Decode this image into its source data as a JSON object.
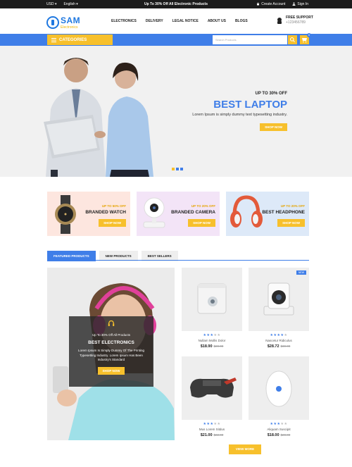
{
  "topbar": {
    "currency": "USD",
    "language": "English",
    "promo": "Up To 30% Off All Electronic Products",
    "account": "Create Account",
    "signin": "Sign In"
  },
  "header": {
    "logo_main": "SAM",
    "logo_sub": "Electronics",
    "nav": [
      "ELECTRONICS",
      "DELIVERY",
      "LEGAL NOTICE",
      "ABOUT US",
      "BLOGS"
    ],
    "support_title": "FREE SUPPORT",
    "support_phone": "+123456789"
  },
  "bar": {
    "categories": "CATEGORIES",
    "search_placeholder": "Search Products",
    "cart_count": "0"
  },
  "hero": {
    "offer": "UP TO 30% OFF",
    "title": "BEST LAPTOP",
    "desc": "Lorem Ipsum is simply dummy text  typesetting industry.",
    "button": "SHOP NOW"
  },
  "promos": [
    {
      "offer": "UP TO 50% OFF",
      "name": "BRANDED WATCH",
      "button": "SHOP NOW"
    },
    {
      "offer": "UP TO 20% OFF",
      "name": "BRANDED CAMERA",
      "button": "SHOP NOW"
    },
    {
      "offer": "UP TO 20% OFF",
      "name": "BEST HEADPHONE",
      "button": "SHOP NOW"
    }
  ],
  "tabs": [
    "FEATURED PRODUCTS",
    "NEW PRODUCTS",
    "BEST SELLERS"
  ],
  "side_promo": {
    "offer": "Up To 30% Off All Products",
    "title": "BEST ELECTRONICS",
    "desc": "Lorem Ipsum Is Simply Dummy Of The Printing Typesetting Industry. Lorem Ipsum Has Been Industry's Standard",
    "button": "SHOP NOW"
  },
  "products": [
    {
      "name": "Nullam Mollis Dolor",
      "price": "$18.90",
      "old": "$20.00",
      "rating": 4,
      "badge": ""
    },
    {
      "name": "Nascetur Ridiculus",
      "price": "$28.72",
      "old": "$30.00",
      "rating": 4,
      "badge": "NEW"
    },
    {
      "name": "Mus Lorem Sitdus",
      "price": "$21.00",
      "old": "$22.00",
      "rating": 3,
      "badge": ""
    },
    {
      "name": "Aliquam Suscipit",
      "price": "$18.00",
      "old": "$20.00",
      "rating": 3,
      "badge": ""
    }
  ],
  "view_more": "VIEW MORE",
  "colors": {
    "blue": "#3f7ee8",
    "yellow": "#f7c02c",
    "dark": "#1c1c1c"
  }
}
